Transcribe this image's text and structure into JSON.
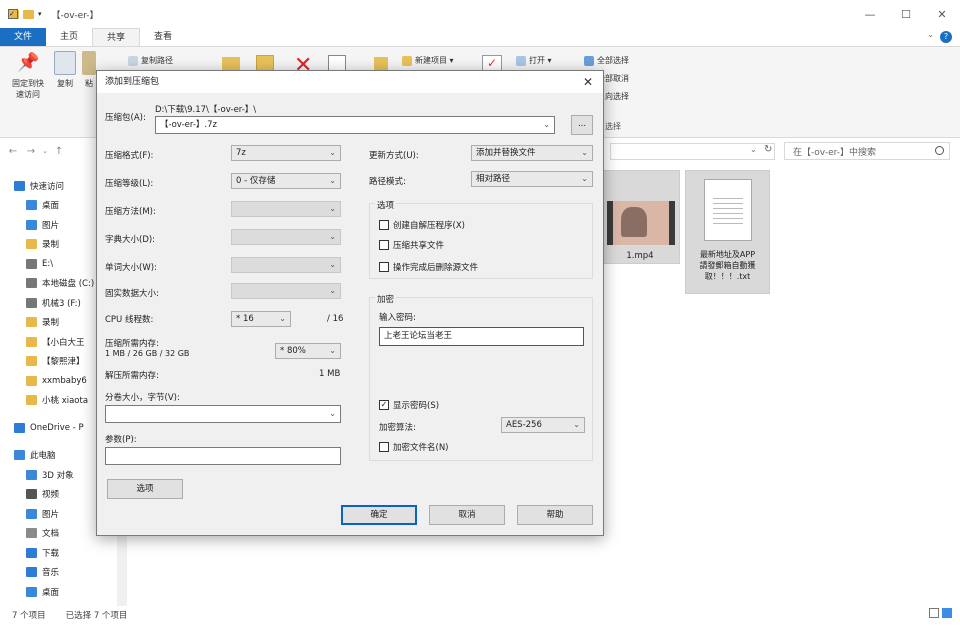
{
  "explorer": {
    "window_title": "【-ov-er-】",
    "tabs": [
      "文件",
      "主页",
      "共享",
      "查看"
    ],
    "ribbon": {
      "pin_label": "固定到快\n速访问",
      "copy_label": "复制",
      "paste_label": "粘",
      "copy_path": "复制路径",
      "new_item": "新建项目 ▾",
      "open": "打开 ▾",
      "select_all": "全部选择",
      "select_none": "全部取消",
      "invert_select": "反向选择",
      "select_group": "选择"
    },
    "search_placeholder": "在【-ov-er-】中搜索",
    "sidebar": {
      "items": [
        {
          "label": "快速访问",
          "icon": "star-icon",
          "color": "#2f7cd6",
          "top": true
        },
        {
          "label": "桌面",
          "icon": "desktop-icon",
          "color": "#3b87d9"
        },
        {
          "label": "图片",
          "icon": "pictures-icon",
          "color": "#3b87d9"
        },
        {
          "label": "录制",
          "icon": "folder-icon",
          "color": "#e8b94a"
        },
        {
          "label": "E:\\",
          "icon": "drive-icon",
          "color": "#777777"
        },
        {
          "label": "本地磁盘 (C:)",
          "icon": "drive-icon",
          "color": "#777777"
        },
        {
          "label": "机械3 (F:)",
          "icon": "drive-icon",
          "color": "#777777"
        },
        {
          "label": "录制",
          "icon": "folder-icon",
          "color": "#e8b94a"
        },
        {
          "label": "【小白大王",
          "icon": "folder-icon",
          "color": "#e8b94a"
        },
        {
          "label": "【黎熙津】",
          "icon": "folder-icon",
          "color": "#e8b94a"
        },
        {
          "label": "xxmbaby6",
          "icon": "folder-icon",
          "color": "#e8b94a"
        },
        {
          "label": "小桃 xiaota",
          "icon": "folder-icon",
          "color": "#e8b94a"
        },
        {
          "label": "OneDrive - P",
          "icon": "cloud-icon",
          "color": "#2f7cd6",
          "top": true
        },
        {
          "label": "此电脑",
          "icon": "pc-icon",
          "color": "#3b87d9",
          "top": true
        },
        {
          "label": "3D 对象",
          "icon": "cube-icon",
          "color": "#3b87d9"
        },
        {
          "label": "视频",
          "icon": "video-icon",
          "color": "#555555"
        },
        {
          "label": "图片",
          "icon": "pictures-icon",
          "color": "#3b87d9"
        },
        {
          "label": "文档",
          "icon": "documents-icon",
          "color": "#8a8a8a"
        },
        {
          "label": "下载",
          "icon": "download-icon",
          "color": "#2f7cd6"
        },
        {
          "label": "音乐",
          "icon": "music-icon",
          "color": "#2f7cd6"
        },
        {
          "label": "桌面",
          "icon": "desktop-icon",
          "color": "#3b87d9"
        }
      ]
    },
    "files": [
      {
        "name": "1.mp4",
        "icon": "video-thumbnail-icon"
      },
      {
        "name": "最新地址及APP\n請發郵箱自動獲\n取！！！.txt",
        "icon": "text-file-icon"
      }
    ],
    "status": {
      "count": "7 个项目",
      "selected": "已选择 7 个项目"
    }
  },
  "dialog": {
    "title": "添加到压缩包",
    "archive_label": "压缩包(A):",
    "archive_path": "D:\\下载\\9.17\\【-ov-er-】\\",
    "archive_name": "【-ov-er-】.7z",
    "browse_label": "...",
    "format_label": "压缩格式(F):",
    "format_value": "7z",
    "level_label": "压缩等级(L):",
    "level_value": "0 - 仅存储",
    "method_label": "压缩方法(M):",
    "dict_label": "字典大小(D):",
    "word_label": "单词大小(W):",
    "solid_label": "固实数据大小:",
    "cpu_label": "CPU 线程数:",
    "cpu_value": "* 16",
    "cpu_total": "/ 16",
    "mem_comp_label": "压缩所需内存:",
    "mem_comp_value": "1 MB / 26 GB / 32 GB",
    "mem_percent": "* 80%",
    "mem_decomp_label": "解压所需内存:",
    "mem_decomp_value": "1 MB",
    "split_label": "分卷大小，字节(V):",
    "params_label": "参数(P):",
    "options_button": "选项",
    "update_label": "更新方式(U):",
    "update_value": "添加并替换文件",
    "path_label": "路径模式:",
    "path_value": "相对路径",
    "options_group": "选项",
    "opt_sfx": "创建自解压程序(X)",
    "opt_shared": "压缩共享文件",
    "opt_delete": "操作完成后删除源文件",
    "encrypt_group": "加密",
    "password_label": "输入密码:",
    "password_value": "上老王论坛当老王",
    "show_password": "显示密码(S)",
    "enc_method_label": "加密算法:",
    "enc_method_value": "AES-256",
    "encrypt_names": "加密文件名(N)",
    "ok": "确定",
    "cancel": "取消",
    "help": "帮助"
  }
}
